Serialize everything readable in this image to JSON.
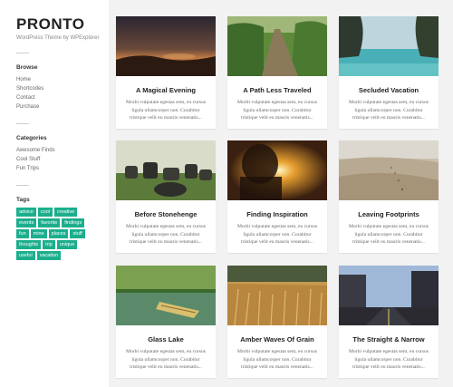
{
  "site": {
    "title": "PRONTO",
    "tagline": "WordPress Theme by WPExplorer"
  },
  "browse": {
    "heading": "Browse",
    "links": [
      "Home",
      "Shortcodes",
      "Contact",
      "Purchase"
    ]
  },
  "categories": {
    "heading": "Categories",
    "links": [
      "Awesome Finds",
      "Cool Stuff",
      "Fun Trips"
    ]
  },
  "tags": {
    "heading": "Tags",
    "items": [
      "advice",
      "cool",
      "creative",
      "events",
      "favorite",
      "findings",
      "fun",
      "mine",
      "places",
      "stuff",
      "thoughts",
      "trip",
      "unique",
      "useful",
      "vacation"
    ]
  },
  "colors": {
    "tag_bg": "#1cae8d",
    "page_bg": "#f2f2f2"
  },
  "posts": [
    {
      "title": "A Magical Evening",
      "excerpt": "Morbi vulputate egestas sem, eu cursus ligula ullamcorper non. Curabitur tristique velit eu mauris venenatis..."
    },
    {
      "title": "A Path Less Traveled",
      "excerpt": "Morbi vulputate egestas sem, eu cursus ligula ullamcorper non. Curabitur tristique velit eu mauris venenatis..."
    },
    {
      "title": "Secluded Vacation",
      "excerpt": "Morbi vulputate egestas sem, eu cursus ligula ullamcorper non. Curabitur tristique velit eu mauris venenatis..."
    },
    {
      "title": "Before Stonehenge",
      "excerpt": "Morbi vulputate egestas sem, eu cursus ligula ullamcorper non. Curabitur tristique velit eu mauris venenatis..."
    },
    {
      "title": "Finding Inspiration",
      "excerpt": "Morbi vulputate egestas sem, eu cursus ligula ullamcorper non. Curabitur tristique velit eu mauris venenatis..."
    },
    {
      "title": "Leaving Footprints",
      "excerpt": "Morbi vulputate egestas sem, eu cursus ligula ullamcorper non. Curabitur tristique velit eu mauris venenatis..."
    },
    {
      "title": "Glass Lake",
      "excerpt": "Morbi vulputate egestas sem, eu cursus ligula ullamcorper non. Curabitur tristique velit eu mauris venenatis..."
    },
    {
      "title": "Amber Waves Of Grain",
      "excerpt": "Morbi vulputate egestas sem, eu cursus ligula ullamcorper non. Curabitur tristique velit eu mauris venenatis..."
    },
    {
      "title": "The Straight & Narrow",
      "excerpt": "Morbi vulputate egestas sem, eu cursus ligula ullamcorper non. Curabitur tristique velit eu mauris venenatis..."
    }
  ]
}
